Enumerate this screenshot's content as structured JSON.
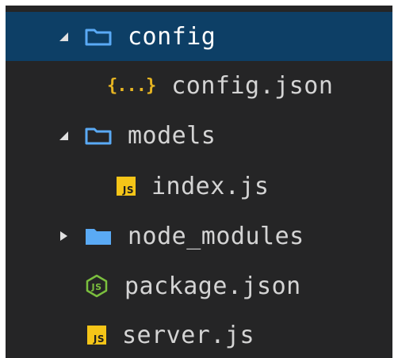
{
  "explorer": {
    "items": [
      {
        "label": "config",
        "type": "folder",
        "state": "expanded",
        "selected": true
      },
      {
        "label": "config.json",
        "type": "json-file"
      },
      {
        "label": "models",
        "type": "folder",
        "state": "expanded"
      },
      {
        "label": "index.js",
        "type": "js-file"
      },
      {
        "label": "node_modules",
        "type": "folder",
        "state": "collapsed"
      },
      {
        "label": "package.json",
        "type": "nodejs-file"
      },
      {
        "label": "server.js",
        "type": "js-file"
      }
    ],
    "icons": {
      "json_glyph": "{...}",
      "js_glyph": "JS"
    },
    "colors": {
      "background": "#252526",
      "selection": "#0d3f66",
      "folder": "#5aaaf5",
      "json": "#e6b422",
      "js": "#f5c518",
      "node": "#7bbf3e"
    }
  }
}
